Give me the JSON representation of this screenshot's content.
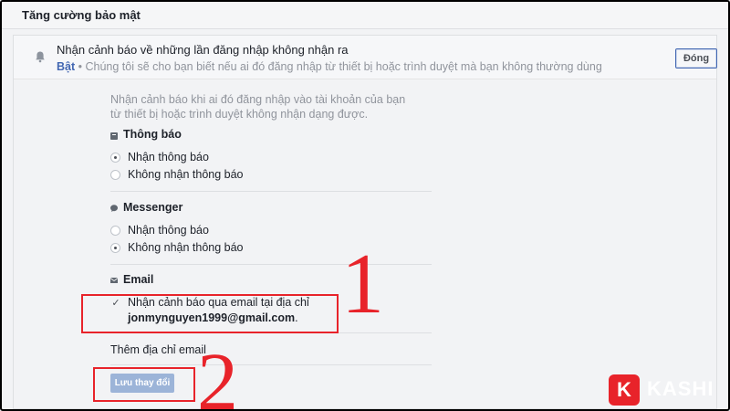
{
  "header": {
    "title": "Tăng cường bảo mật"
  },
  "notice": {
    "icon": "bell-icon",
    "title": "Nhận cảnh báo về những lần đăng nhập không nhận ra",
    "status": "Bật",
    "separator": " • ",
    "description": "Chúng tôi sẽ cho bạn biết nếu ai đó đăng nhập từ thiết bị hoặc trình duyệt mà bạn không thường dùng",
    "close_label": "Đóng"
  },
  "intro": "Nhận cảnh báo khi ai đó đăng nhập vào tài khoản của bạn từ thiết bị hoặc trình duyệt không nhận dạng được.",
  "sections": {
    "notifications": {
      "icon": "notification-icon",
      "title": "Thông báo",
      "options": [
        {
          "label": "Nhận thông báo",
          "selected": true
        },
        {
          "label": "Không nhận thông báo",
          "selected": false
        }
      ]
    },
    "messenger": {
      "icon": "messenger-icon",
      "title": "Messenger",
      "options": [
        {
          "label": "Nhận thông báo",
          "selected": false
        },
        {
          "label": "Không nhận thông báo",
          "selected": true
        }
      ]
    },
    "email": {
      "icon": "envelope-icon",
      "title": "Email",
      "checkbox_label": "Nhận cảnh báo qua email tại địa chỉ",
      "address": "jonmynguyen1999@gmail.com",
      "address_suffix": ".",
      "checked": true
    }
  },
  "add_email_label": "Thêm địa chỉ email",
  "save_label": "Lưu thay đổi",
  "annotations": {
    "one": "1",
    "two": "2",
    "color": "#e8232a"
  },
  "logo": {
    "mark": "K",
    "text": "KASHI"
  },
  "colors": {
    "accent": "#4267b2",
    "save_disabled": "#9cb4d8",
    "annotation": "#e8232a"
  }
}
